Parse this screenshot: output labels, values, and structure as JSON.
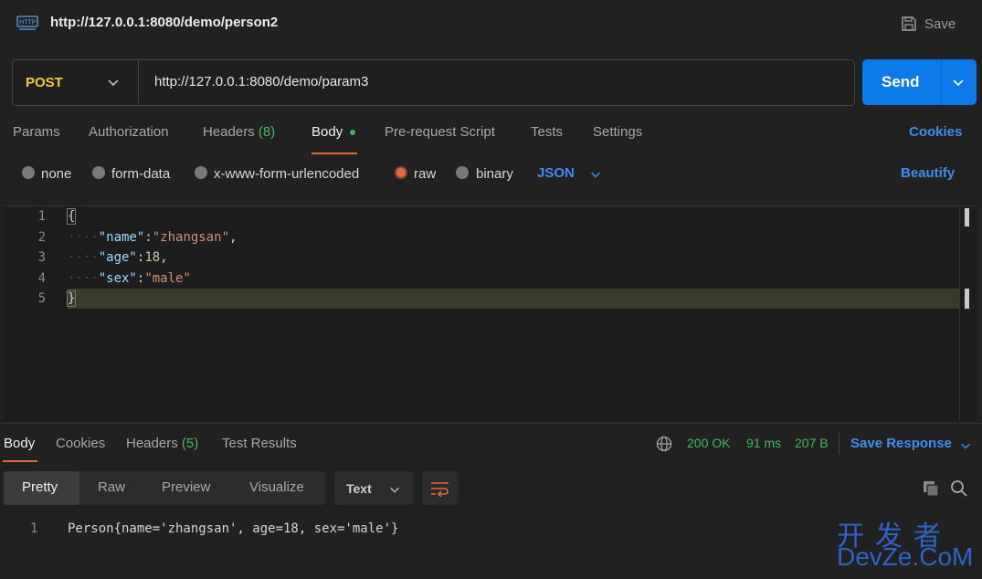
{
  "header": {
    "title": "http://127.0.0.1:8080/demo/person2",
    "icon": "http-icon",
    "save_label": "Save"
  },
  "request": {
    "method": "POST",
    "url": "http://127.0.0.1:8080/demo/param3",
    "send_label": "Send"
  },
  "request_tabs": {
    "params": "Params",
    "authorization": "Authorization",
    "headers": "Headers",
    "headers_count": "(8)",
    "body": "Body",
    "prerequest": "Pre-request Script",
    "tests": "Tests",
    "settings": "Settings",
    "cookies": "Cookies"
  },
  "body_types": {
    "none": "none",
    "form_data": "form-data",
    "urlencoded": "x-www-form-urlencoded",
    "raw": "raw",
    "binary": "binary",
    "selected": "raw",
    "language": "JSON",
    "beautify": "Beautify"
  },
  "editor": {
    "line_numbers": [
      "1",
      "2",
      "3",
      "4",
      "5"
    ],
    "line1": "{",
    "l2_key": "\"name\"",
    "l2_val": "\"zhangsan\"",
    "l3_key": "\"age\"",
    "l3_val": "18",
    "l4_key": "\"sex\"",
    "l4_val": "\"male\"",
    "line5": "}",
    "colon": ":",
    "comma": ","
  },
  "response_tabs": {
    "body": "Body",
    "cookies": "Cookies",
    "headers": "Headers",
    "headers_count": "(5)",
    "test_results": "Test Results"
  },
  "response_status": {
    "status": "200 OK",
    "time": "91 ms",
    "size": "207 B",
    "save_response": "Save Response"
  },
  "view_modes": {
    "pretty": "Pretty",
    "raw": "Raw",
    "preview": "Preview",
    "visualize": "Visualize",
    "format": "Text"
  },
  "response_body": {
    "line_number": "1",
    "text": "Person{name='zhangsan', age=18, sex='male'}"
  },
  "watermark": {
    "top": "开发者",
    "bottom": "DevZe.CoM"
  },
  "colors": {
    "accent": "#0b79e8",
    "method": "#f2c744",
    "active_underline": "#e5673f",
    "status_ok": "#43b85d",
    "link": "#3d8eef"
  }
}
